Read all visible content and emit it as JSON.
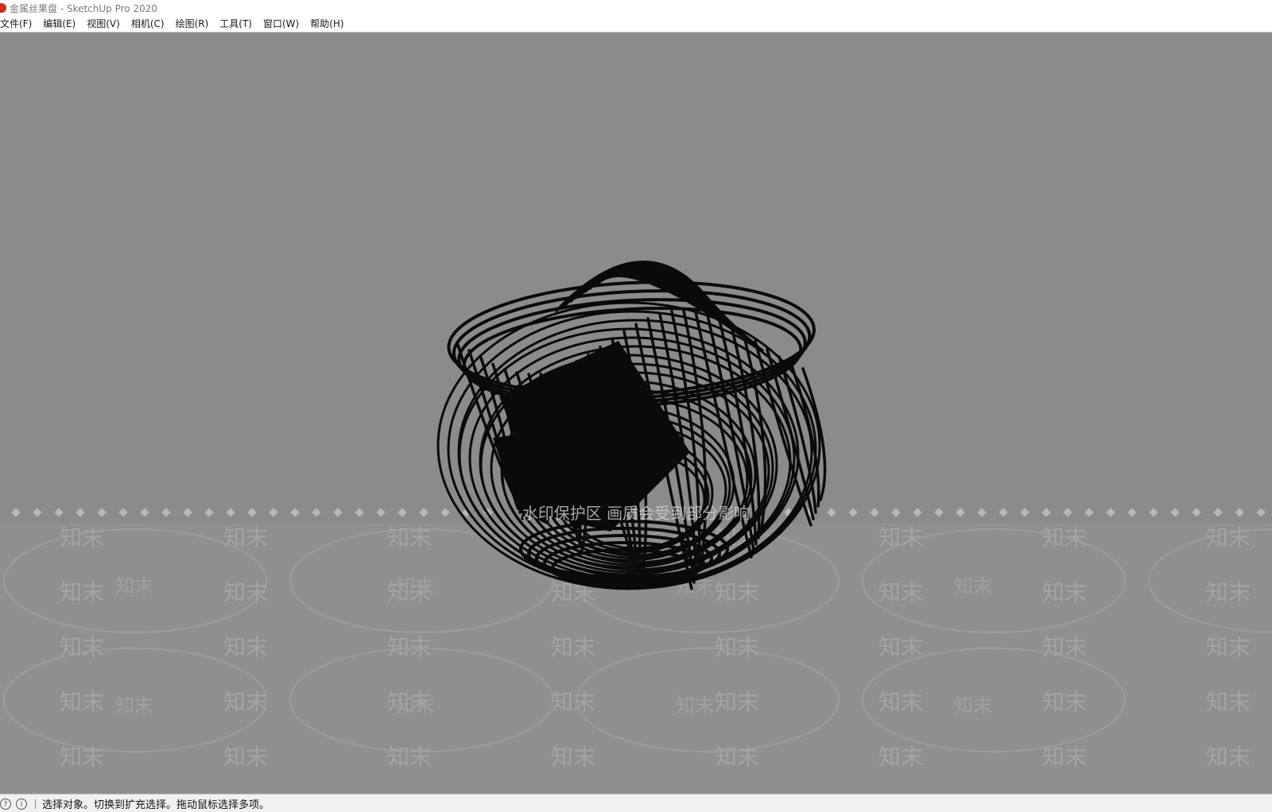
{
  "window": {
    "title": "金属丝果盘 - SketchUp Pro 2020"
  },
  "menubar": {
    "items": [
      {
        "label": "文件(F)"
      },
      {
        "label": "编辑(E)"
      },
      {
        "label": "视图(V)"
      },
      {
        "label": "相机(C)"
      },
      {
        "label": "绘图(R)"
      },
      {
        "label": "工具(T)"
      },
      {
        "label": "窗口(W)"
      },
      {
        "label": "帮助(H)"
      }
    ]
  },
  "viewport": {
    "background": "#8b8b8b",
    "model_color": "#0a0a0a",
    "watermark_notice": "水印保护区   画质会受到部分影响",
    "watermark_text": "知末"
  },
  "statusbar": {
    "icons": [
      "help-icon",
      "info-icon"
    ],
    "message": "选择对象。切换到扩充选择。拖动鼠标选择多项。"
  }
}
